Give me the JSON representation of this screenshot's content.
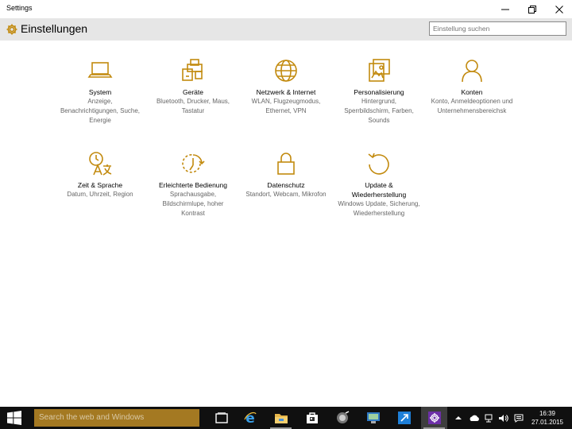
{
  "window": {
    "title": "Settings",
    "controls": [
      "minimize",
      "maximize",
      "close"
    ]
  },
  "header": {
    "title": "Einstellungen",
    "icon": "gear-icon",
    "search_placeholder": "Einstellung suchen"
  },
  "accent_color": "#c28a0e",
  "categories": [
    {
      "name": "System",
      "desc": "Anzeige, Benachrichtigungen, Suche, Energie",
      "icon": "laptop-icon"
    },
    {
      "name": "Geräte",
      "desc": "Bluetooth, Drucker, Maus, Tastatur",
      "icon": "devices-icon"
    },
    {
      "name": "Netzwerk & Internet",
      "desc": "WLAN, Flugzeugmodus, Ethernet, VPN",
      "icon": "globe-icon"
    },
    {
      "name": "Personalisierung",
      "desc": "Hintergrund, Sperrbildschirm, Farben, Sounds",
      "icon": "paint-icon"
    },
    {
      "name": "Konten",
      "desc": "Konto, Anmeldeoptionen und Unternehmensbereichsk",
      "icon": "person-icon"
    },
    {
      "name": "Zeit & Sprache",
      "desc": "Datum, Uhrzeit, Region",
      "icon": "time-language-icon"
    },
    {
      "name": "Erleichterte Bedienung",
      "desc": "Sprachausgabe, Bildschirmlupe, hoher Kontrast",
      "icon": "ease-of-access-icon"
    },
    {
      "name": "Datenschutz",
      "desc": "Standort, Webcam, Mikrofon",
      "icon": "lock-icon"
    },
    {
      "name": "Update & Wiederherstellung",
      "desc": "Windows Update, Sicherung, Wiederherstellung",
      "icon": "update-icon"
    }
  ],
  "taskbar": {
    "search_placeholder": "Search the web and Windows",
    "search_color": "#a47922",
    "apps": [
      "task-view",
      "internet-explorer",
      "file-explorer",
      "store",
      "photos",
      "app-6",
      "app-7",
      "settings"
    ],
    "clock_time": "16:39",
    "clock_date": "27.01.2015"
  }
}
